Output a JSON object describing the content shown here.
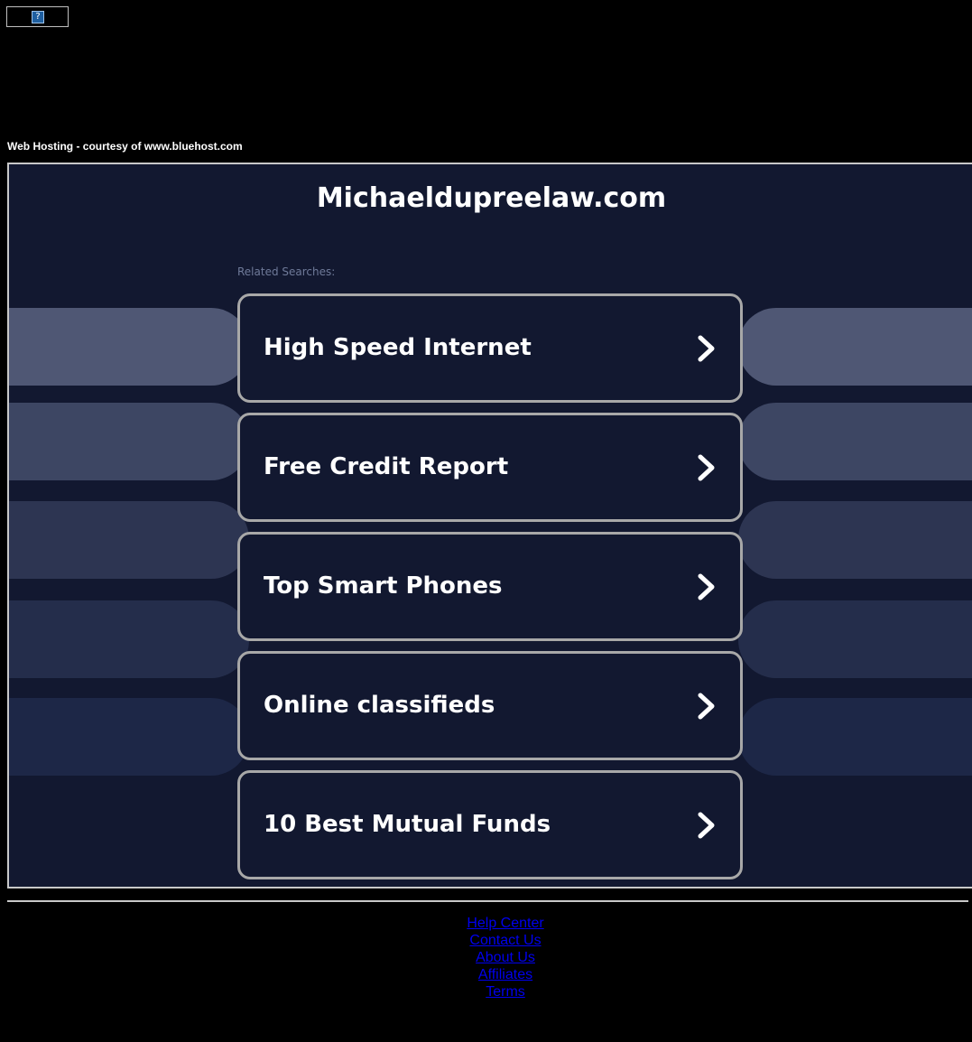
{
  "top_ad": {
    "icon": "broken-image-icon",
    "glyph": "?"
  },
  "courtesy_text": "Web Hosting - courtesy of www.bluehost.com",
  "domain": "Michaeldupreelaw.com",
  "related_label": "Related Searches:",
  "links": [
    {
      "label": "High Speed Internet"
    },
    {
      "label": "Free Credit Report"
    },
    {
      "label": "Top Smart Phones"
    },
    {
      "label": "Online classifieds"
    },
    {
      "label": "10 Best Mutual Funds"
    }
  ],
  "footer_links": [
    {
      "label": "Help Center"
    },
    {
      "label": "Contact Us"
    },
    {
      "label": "About Us"
    },
    {
      "label": "Affiliates"
    },
    {
      "label": "Terms"
    }
  ],
  "colors": {
    "page_bg": "#000000",
    "frame_bg": "#121830",
    "box_border": "#a8a8a8",
    "footer_link": "#0000ee",
    "related_text": "#6f7a99"
  }
}
